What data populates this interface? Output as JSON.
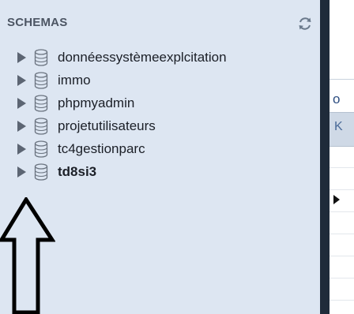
{
  "sidebar": {
    "title": "SCHEMAS",
    "refresh_icon": "refresh-icon",
    "schemas": [
      {
        "label": "donnéessystèmeexplcitation"
      },
      {
        "label": "immo"
      },
      {
        "label": "phpmyadmin"
      },
      {
        "label": "projetutilisateurs"
      },
      {
        "label": "tc4gestionparc"
      },
      {
        "label": "td8si3",
        "active": true
      }
    ]
  },
  "right_panel": {
    "tab_letter": "o",
    "band_letter": "K"
  },
  "annotation": {
    "icon": "up-arrow-icon"
  },
  "colors": {
    "sidebar_bg": "#dde6f2",
    "divider": "#1f2b3a",
    "text": "#1b1f27"
  }
}
